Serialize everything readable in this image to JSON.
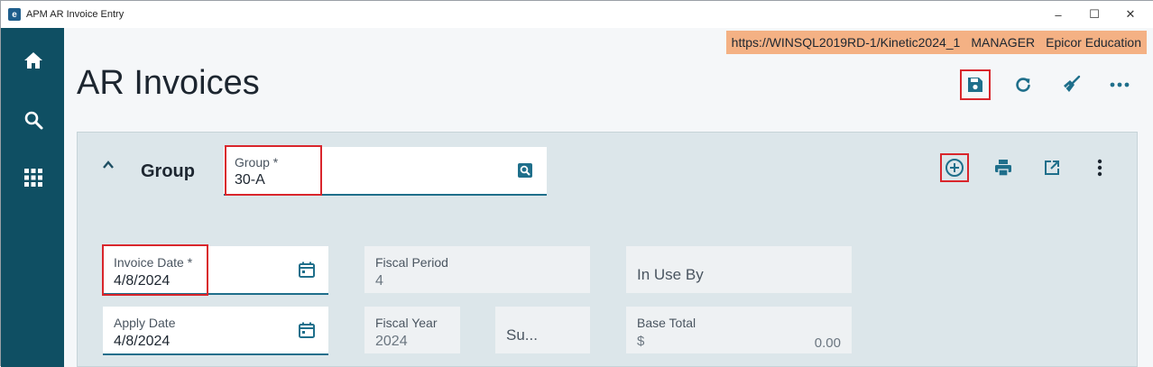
{
  "window": {
    "title": "APM AR Invoice Entry",
    "logo_letter": "e",
    "minimize": "–",
    "maximize": "☐",
    "close": "✕"
  },
  "env": {
    "url": "https://WINSQL2019RD-1/Kinetic2024_1",
    "user": "MANAGER",
    "company": "Epicor Education"
  },
  "page": {
    "title": "AR Invoices"
  },
  "group": {
    "label": "Group",
    "field": {
      "label": "Group *",
      "value": "30-A"
    }
  },
  "fields": {
    "invoice_date": {
      "label": "Invoice Date *",
      "value": "4/8/2024"
    },
    "apply_date": {
      "label": "Apply Date",
      "value": "4/8/2024"
    },
    "fiscal_period": {
      "label": "Fiscal Period",
      "value": "4"
    },
    "fiscal_year": {
      "label": "Fiscal Year",
      "value": "2024"
    },
    "su": {
      "label": "Su..."
    },
    "in_use_by": {
      "label": "In Use By"
    },
    "base_total": {
      "label": "Base Total",
      "currency": "$",
      "value": "0.00"
    }
  },
  "colors": {
    "sidebar": "#0f4f63",
    "accent": "#1f6f8b",
    "banner": "#f4b184",
    "highlight": "#d9262c"
  },
  "icons": {
    "sidebar": [
      "home-icon",
      "search-icon",
      "apps-grid-icon"
    ],
    "toolbar": [
      "save-icon",
      "refresh-icon",
      "clear-broom-icon",
      "more-horizontal-icon"
    ],
    "group_toolbar": [
      "add-circle-icon",
      "print-icon",
      "open-external-icon",
      "more-vertical-icon"
    ]
  }
}
